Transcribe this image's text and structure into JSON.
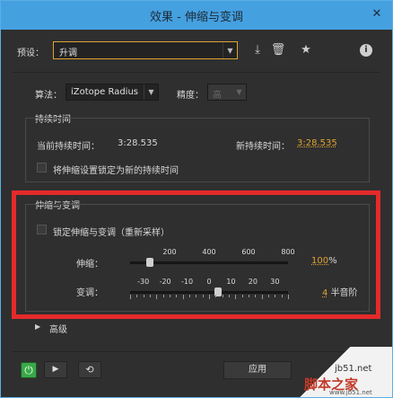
{
  "window": {
    "title": "效果 - 伸缩与变调",
    "close_glyph": "✕"
  },
  "preset": {
    "label": "预设：",
    "value": "升调"
  },
  "algorithm": {
    "label": "算法：",
    "value": "iZotope Radius",
    "precision_label": "精度：",
    "precision_value": "高"
  },
  "duration": {
    "title": "持续时间",
    "current_label": "当前持续时间：",
    "current_value": "3:28.535",
    "new_label": "新持续时间：",
    "new_value": "3:28.535",
    "lock_label": "将伸缩设置锁定为新的持续时间"
  },
  "stretch_pitch": {
    "title": "伸缩与变调",
    "lock_label": "锁定伸缩与变调（重新采样）",
    "stretch": {
      "label": "伸缩：",
      "tick_labels": [
        "200",
        "400",
        "600",
        "800"
      ],
      "value_num": "100",
      "value_unit": "%",
      "value": 100,
      "min": 0,
      "max": 800
    },
    "pitch": {
      "label": "变调：",
      "tick_labels": [
        "-30",
        "-20",
        "-10",
        "0",
        "10",
        "20",
        "30"
      ],
      "value_num": "4",
      "value_unit": "半音阶",
      "value": 4,
      "min": -36,
      "max": 36
    }
  },
  "advanced": {
    "label": "高级"
  },
  "footer": {
    "apply_label": "应用"
  },
  "watermark": {
    "site": "jb51.net",
    "brand": "脚本之家",
    "url": "www.jb51.net"
  }
}
